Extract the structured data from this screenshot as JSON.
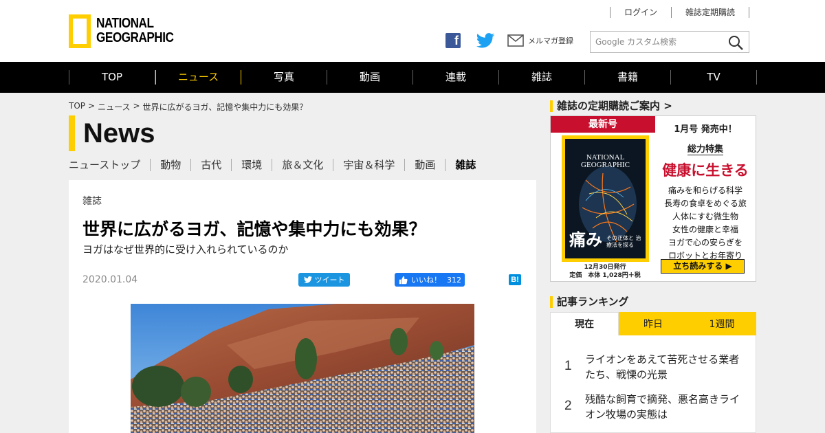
{
  "header": {
    "logo_line1": "NATIONAL",
    "logo_line2": "GEOGRAPHIC",
    "login": "ログイン",
    "subscribe": "雑誌定期購読",
    "mail_label": "メルマガ登録",
    "search_placeholder": "Google カスタム検索"
  },
  "nav": [
    "TOP",
    "ニュース",
    "写真",
    "動画",
    "連載",
    "雑誌",
    "書籍",
    "TV"
  ],
  "nav_active": "ニュース",
  "breadcrumb": [
    "TOP",
    "ニュース",
    "世界に広がるヨガ、記憶や集中力にも効果？"
  ],
  "section_title": "News",
  "subnav": [
    "ニューストップ",
    "動物",
    "古代",
    "環境",
    "旅＆文化",
    "宇宙＆科学",
    "動画",
    "雑誌"
  ],
  "article": {
    "category": "雑誌",
    "headline": "世界に広がるヨガ、記憶や集中力にも効果？",
    "subhead": "ヨガはなぜ世界的に受け入れられているのか",
    "date": "2020.01.04",
    "tweet_label": "ツイート",
    "like_label": "いいね！",
    "like_count": "312",
    "hatena_label": "B!"
  },
  "sidebar": {
    "subscription_heading": "雑誌の定期購読ご案内",
    "promo": {
      "latest_label": "最新号",
      "cover_title": "NATIONAL GEOGRAPHIC",
      "cover_big": "痛み",
      "cover_small": "その正体と 治療法を探る",
      "issue": "1月号 発売中！",
      "feature_label": "総力特集",
      "feature_title": "健康に生きる",
      "topics": [
        "痛みを和らげる科学",
        "長寿の食卓をめぐる旅",
        "人体にすむ微生物",
        "女性の健康と幸福",
        "ヨガで心の安らぎを",
        "ロボットとお年寄り"
      ],
      "publish_date": "12月30日発行",
      "price": "定価　本体 1,028円＋税",
      "read_button": "立ち読みする ▶"
    },
    "ranking_heading": "記事ランキング",
    "ranking_tabs": [
      "現在",
      "昨日",
      "1週間"
    ],
    "ranking_items": [
      {
        "rank": "1",
        "title": "ライオンをあえて苦死させる業者たち、戦慄の光景"
      },
      {
        "rank": "2",
        "title": "残酷な飼育で摘発、悪名高きライオン牧場の実態は"
      }
    ]
  },
  "colors": {
    "brand_yellow": "#ffce00",
    "nav_bg": "#000000",
    "accent_red": "#c8102e",
    "twitter_blue": "#1b95e0",
    "facebook_blue": "#1877f2"
  }
}
